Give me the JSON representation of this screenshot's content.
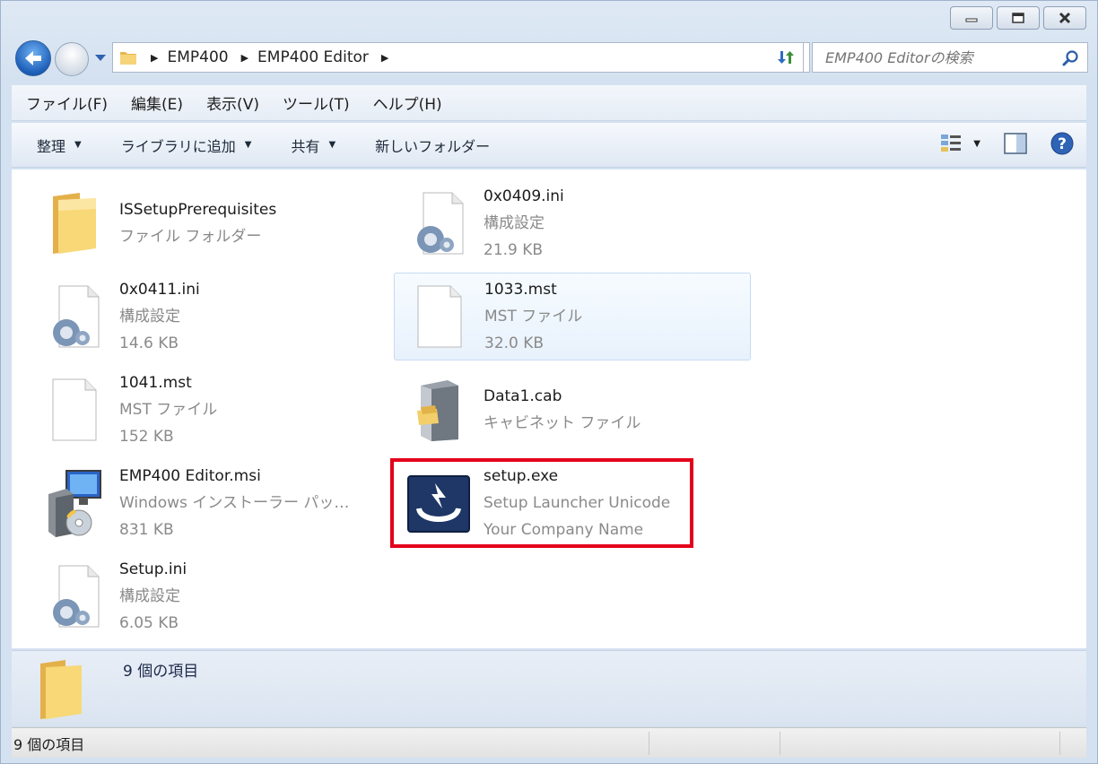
{
  "window": {
    "minimize_label": "",
    "maximize_label": "",
    "close_label": ""
  },
  "address": {
    "crumbs": [
      "EMP400",
      "EMP400 Editor"
    ]
  },
  "search": {
    "placeholder": "EMP400 Editorの検索"
  },
  "menu": {
    "items": [
      "ファイル(F)",
      "編集(E)",
      "表示(V)",
      "ツール(T)",
      "ヘルプ(H)"
    ]
  },
  "commands": {
    "organize": "整理",
    "add_to_library": "ライブラリに追加",
    "share": "共有",
    "new_folder": "新しいフォルダー"
  },
  "files": [
    {
      "name": "ISSetupPrerequisites",
      "line2": "ファイル フォルダー",
      "line3": "",
      "icon": "folder-icon"
    },
    {
      "name": "0x0409.ini",
      "line2": "構成設定",
      "line3": "21.9 KB",
      "icon": "config-file-icon"
    },
    {
      "name": "0x0411.ini",
      "line2": "構成設定",
      "line3": "14.6 KB",
      "icon": "config-file-icon"
    },
    {
      "name": "1033.mst",
      "line2": "MST ファイル",
      "line3": "32.0 KB",
      "icon": "blank-file-icon"
    },
    {
      "name": "1041.mst",
      "line2": "MST ファイル",
      "line3": "152 KB",
      "icon": "blank-file-icon"
    },
    {
      "name": "Data1.cab",
      "line2": "キャビネット ファイル",
      "line3": "",
      "icon": "cabinet-icon"
    },
    {
      "name": "EMP400 Editor.msi",
      "line2": "Windows インストーラー パッ…",
      "line3": "831 KB",
      "icon": "installer-icon"
    },
    {
      "name": "setup.exe",
      "line2": "Setup Launcher Unicode",
      "line3": "Your Company Name",
      "icon": "setup-launcher-icon"
    },
    {
      "name": "Setup.ini",
      "line2": "構成設定",
      "line3": "6.05 KB",
      "icon": "config-file-icon"
    }
  ],
  "details": {
    "count_text": "9 個の項目"
  },
  "status": {
    "count_text": "9 個の項目"
  },
  "colors": {
    "highlight": "#e3001b",
    "selection_bg": "#e8f2fc"
  }
}
